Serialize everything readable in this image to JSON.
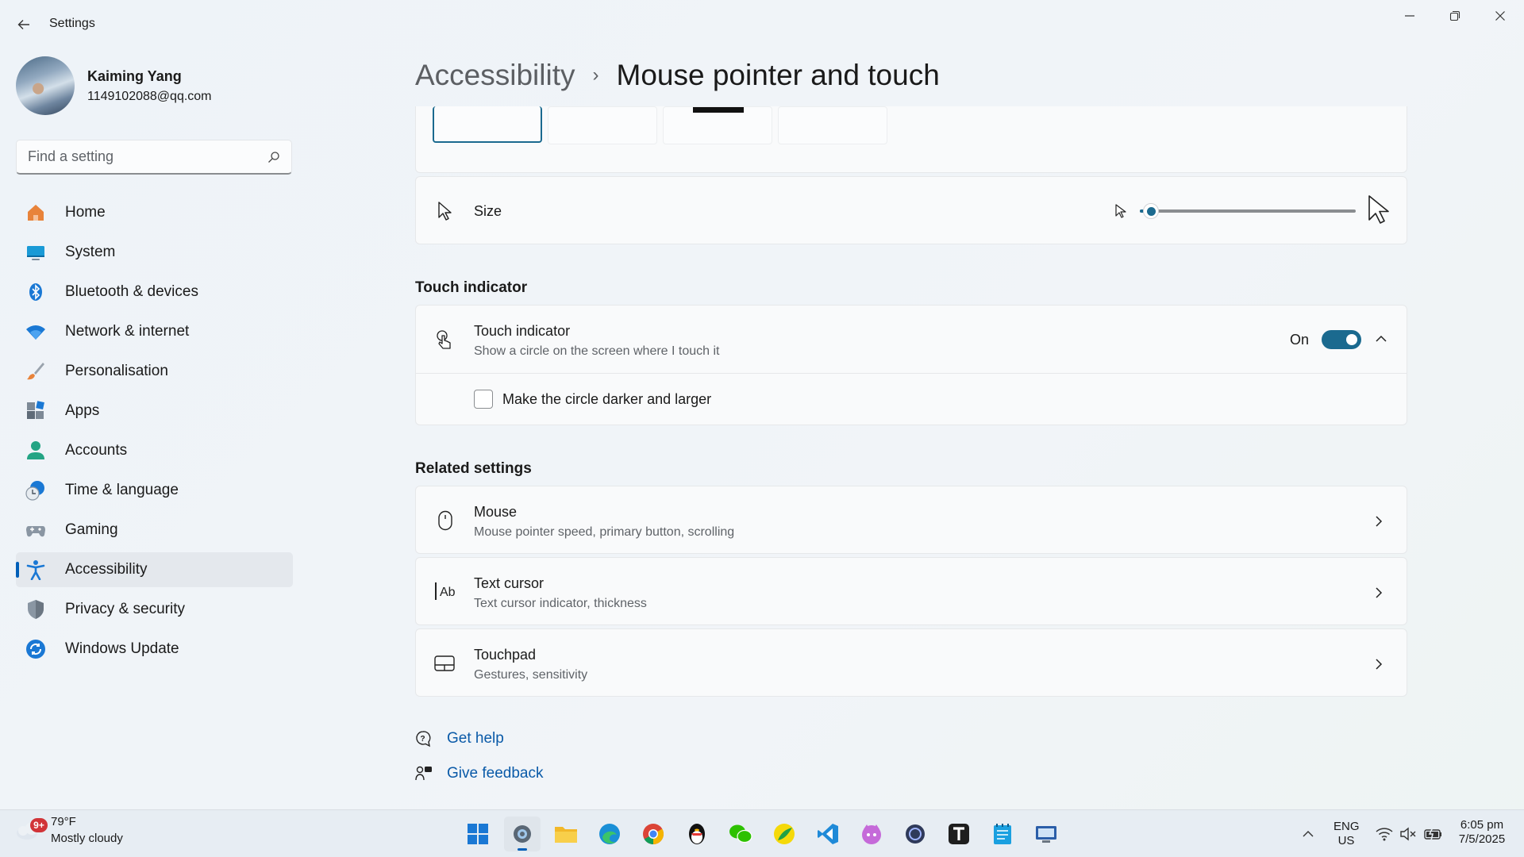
{
  "window": {
    "title": "Settings"
  },
  "profile": {
    "name": "Kaiming Yang",
    "email": "1149102088@qq.com"
  },
  "search": {
    "placeholder": "Find a setting"
  },
  "sidebar": {
    "items": [
      {
        "label": "Home",
        "icon": "home-icon"
      },
      {
        "label": "System",
        "icon": "system-icon"
      },
      {
        "label": "Bluetooth & devices",
        "icon": "bluetooth-icon"
      },
      {
        "label": "Network & internet",
        "icon": "wifi-icon"
      },
      {
        "label": "Personalisation",
        "icon": "brush-icon"
      },
      {
        "label": "Apps",
        "icon": "apps-icon"
      },
      {
        "label": "Accounts",
        "icon": "accounts-icon"
      },
      {
        "label": "Time & language",
        "icon": "time-language-icon"
      },
      {
        "label": "Gaming",
        "icon": "gaming-icon"
      },
      {
        "label": "Accessibility",
        "icon": "accessibility-icon",
        "active": true
      },
      {
        "label": "Privacy & security",
        "icon": "shield-icon"
      },
      {
        "label": "Windows Update",
        "icon": "windows-update-icon"
      }
    ]
  },
  "breadcrumb": {
    "parent": "Accessibility",
    "separator": "›",
    "current": "Mouse pointer and touch"
  },
  "size_row": {
    "label": "Size",
    "slider_value_fraction": 0.05
  },
  "touch_section": {
    "title": "Touch indicator",
    "row_title": "Touch indicator",
    "row_subtitle": "Show a circle on the screen where I touch it",
    "toggle_label": "On",
    "toggle_on": true,
    "checkbox_label": "Make the circle darker and larger",
    "checkbox_checked": false
  },
  "related": {
    "title": "Related settings",
    "items": [
      {
        "title": "Mouse",
        "subtitle": "Mouse pointer speed, primary button, scrolling",
        "icon": "mouse-icon"
      },
      {
        "title": "Text cursor",
        "subtitle": "Text cursor indicator, thickness",
        "icon": "text-cursor-icon"
      },
      {
        "title": "Touchpad",
        "subtitle": "Gestures, sensitivity",
        "icon": "touchpad-icon"
      }
    ]
  },
  "links": {
    "help": "Get help",
    "feedback": "Give feedback"
  },
  "taskbar": {
    "weather_badge": "9+",
    "weather_temp": "79°F",
    "weather_desc": "Mostly cloudy",
    "language_line1": "ENG",
    "language_line2": "US",
    "time": "6:05 pm",
    "date": "7/5/2025"
  },
  "colors": {
    "accent": "#005fb8",
    "toggle_on": "#1b6a8f",
    "link": "#0a5aa8"
  }
}
